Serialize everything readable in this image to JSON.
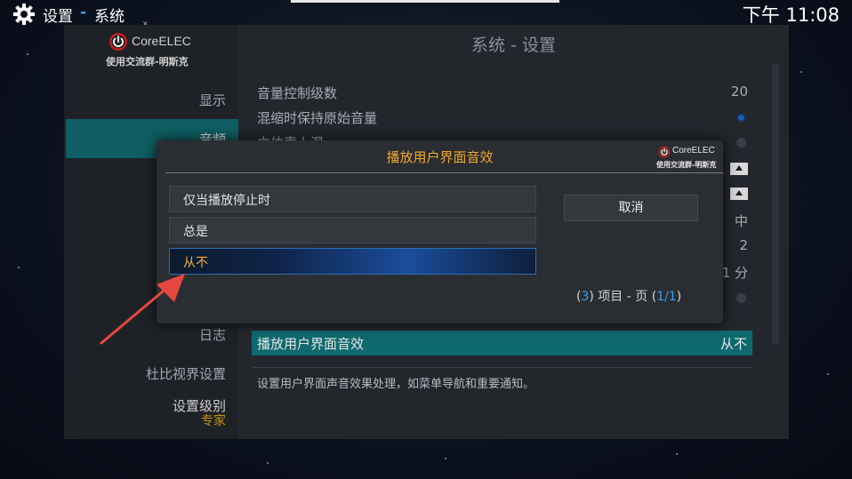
{
  "topbar": {
    "breadcrumb_section": "设置",
    "breadcrumb_separator": "-",
    "breadcrumb_page": "系统",
    "clock": "下午 11:08"
  },
  "brand": {
    "name": "CoreELEC",
    "group": "使用交流群-明斯克"
  },
  "content": {
    "title": "系统 - 设置",
    "rows": [
      {
        "label": "音量控制级数",
        "value": "20"
      },
      {
        "label": "混缩时保持原始音量",
        "value": ""
      },
      {
        "label": "立体声上混",
        "value": ""
      },
      {
        "label": "",
        "value": ""
      },
      {
        "label": "",
        "value": ""
      },
      {
        "label": "",
        "value": "中"
      },
      {
        "label": "",
        "value": "2"
      },
      {
        "label": "",
        "value": "1 分"
      }
    ],
    "selected_row": {
      "label": "播放用户界面音效",
      "value": "从不"
    },
    "description": "设置用户界面声音效果处理，如菜单导航和重要通知。"
  },
  "sidebar": {
    "items": [
      {
        "label": "显示"
      },
      {
        "label": "音频"
      },
      {
        "label": "日志"
      },
      {
        "label": "杜比视界设置"
      }
    ],
    "level_label": "设置级别",
    "level_value": "专家"
  },
  "dialog": {
    "title": "播放用户界面音效",
    "options": [
      {
        "label": "仅当播放停止时"
      },
      {
        "label": "总是"
      },
      {
        "label": "从不"
      }
    ],
    "cancel_label": "取消",
    "pager": {
      "open1": "(",
      "count": "3",
      "close1": ")",
      "items_text": " 项目 - 页 (",
      "page": "1/1",
      "close2": ")"
    }
  }
}
